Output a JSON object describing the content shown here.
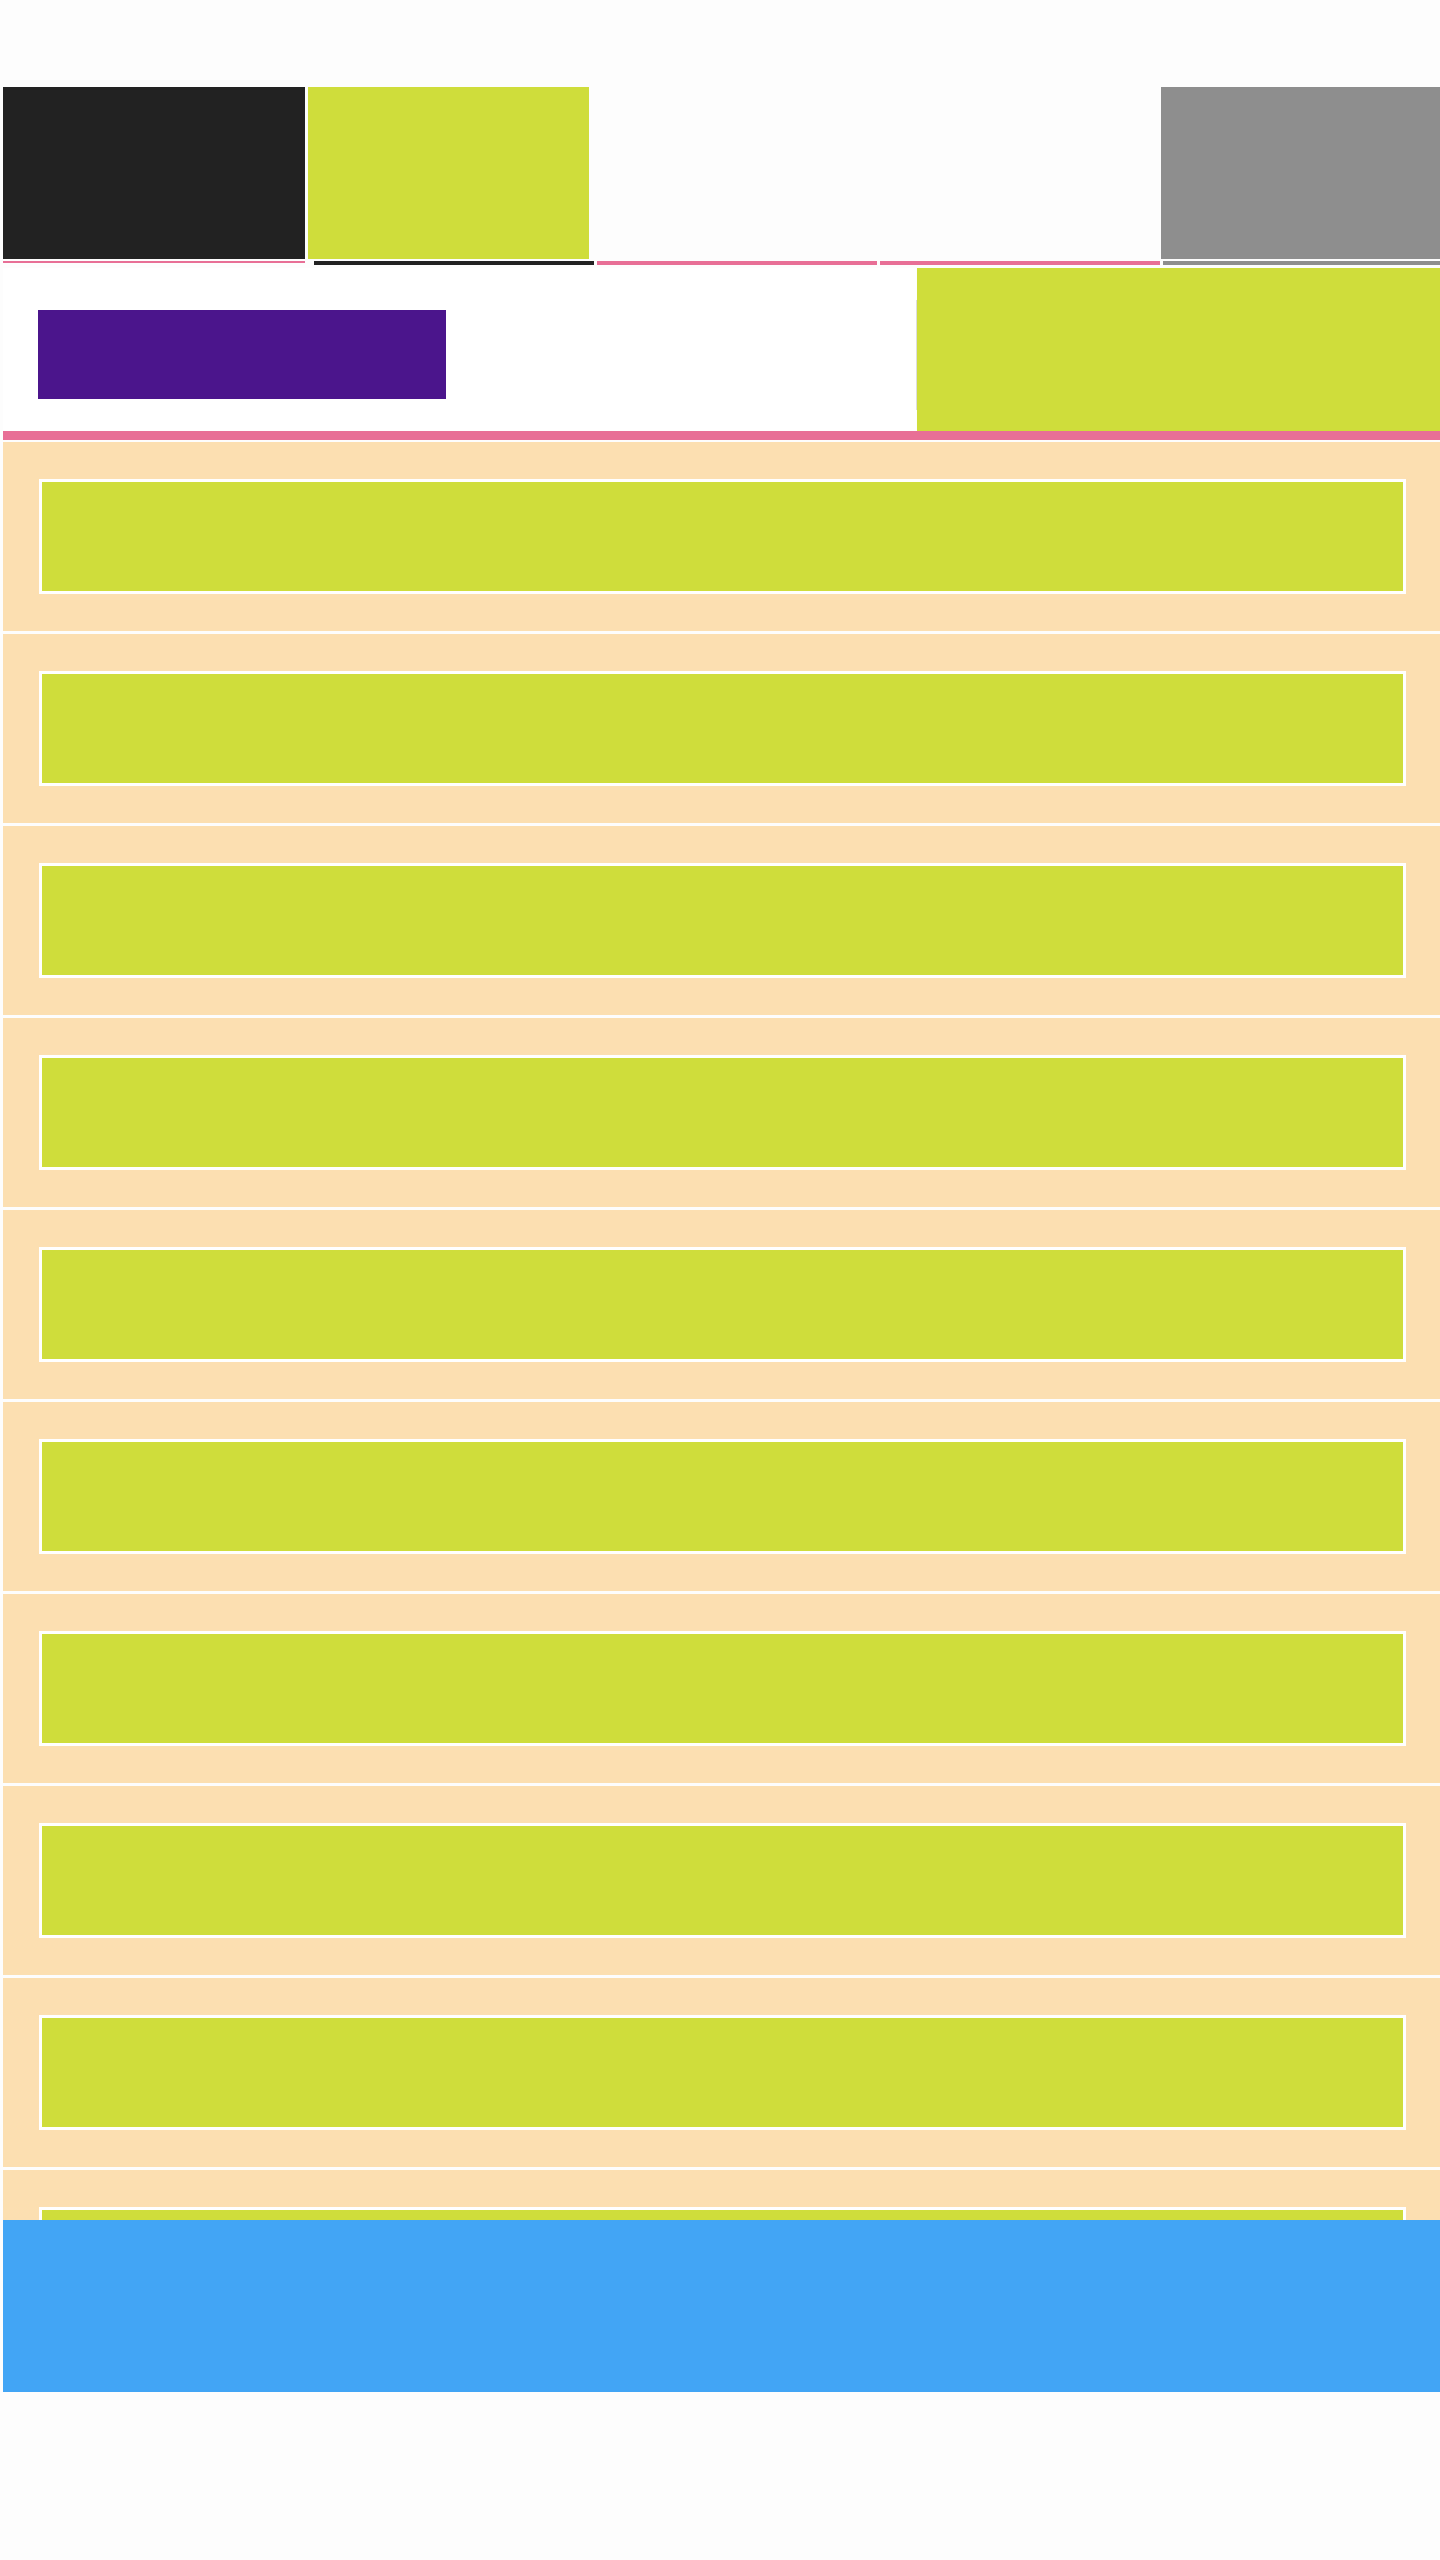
{
  "colors": {
    "page_background": "#fdfdfd",
    "tab_dark": "#222222",
    "tab_accent": "#cfdd3b",
    "tab_gray": "#8e8e8e",
    "tab_underline_pink": "#e86f96",
    "tab_underline_dark": "#222222",
    "primary_button": "#4b158c",
    "header_right_panel": "#cfdd3b",
    "list_item_background": "#fcdfb1",
    "list_item_inner": "#cfdd3b",
    "bottom_bar": "#42a5f5"
  },
  "tabs": [
    {
      "name": "tab-1",
      "label": ""
    },
    {
      "name": "tab-2",
      "label": ""
    },
    {
      "name": "tab-3",
      "label": ""
    },
    {
      "name": "tab-4",
      "label": ""
    },
    {
      "name": "tab-5",
      "label": ""
    }
  ],
  "header": {
    "primary_button_label": "",
    "right_panel_label": ""
  },
  "list": {
    "items": [
      {
        "label": ""
      },
      {
        "label": ""
      },
      {
        "label": ""
      },
      {
        "label": ""
      },
      {
        "label": ""
      },
      {
        "label": ""
      },
      {
        "label": ""
      },
      {
        "label": ""
      },
      {
        "label": ""
      },
      {
        "label": ""
      }
    ]
  },
  "bottom_bar": {
    "label": ""
  }
}
